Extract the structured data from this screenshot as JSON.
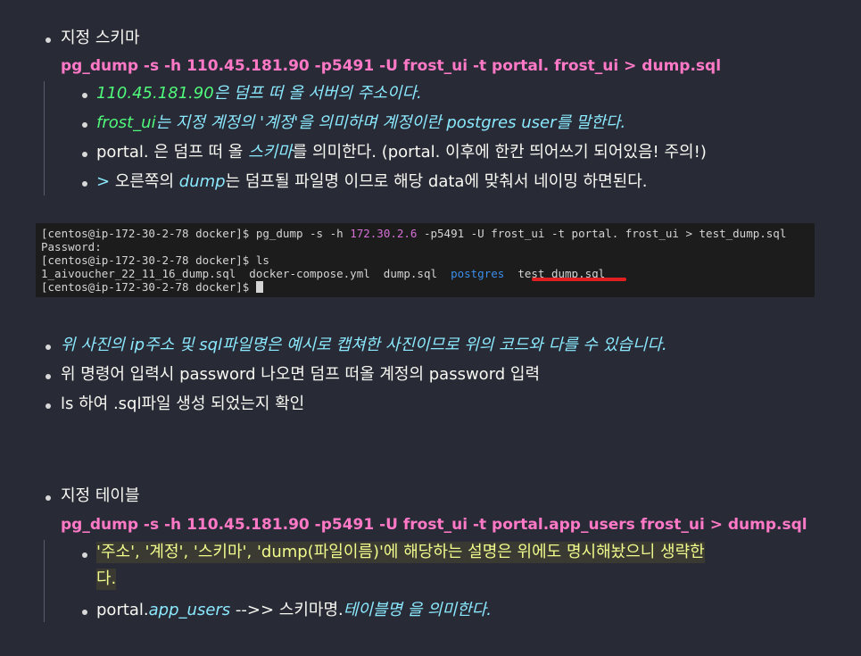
{
  "section1": {
    "title": "지정 스키마",
    "command": "pg_dump -s -h 110.45.181.90 -p5491 -U frost_ui -t portal. frost_ui > dump.sql",
    "items": [
      {
        "a": "110.45.181.90",
        "b": "은 덤프 떠 올 서버의 주소이다."
      },
      {
        "a": "frost_ui",
        "b": "는 지정 계정의 '계정'을 의미하며 계정이란 postgres user를 말한다."
      },
      {
        "a": "portal. 은 덤프 떠 올 ",
        "b": "스키마",
        "c": "를 의미한다. (portal. 이후에 한칸 띄어쓰기 되어있음! 주의!)"
      },
      {
        "a": "> ",
        "b": "오른쪽의 ",
        "c": "dump",
        "d": "는 덤프될 파일명 이므로 해당 data에 맞춰서 네이밍 하면된다."
      }
    ]
  },
  "terminal": {
    "line1_pre": "[centos@ip-172-30-2-78 docker]$ pg_dump -s -h ",
    "line1_ip": "172.30.2.6",
    "line1_post": " -p5491 -U frost_ui -t portal. frost_ui > test_dump.sql",
    "line2": "Password:",
    "line3": "[centos@ip-172-30-2-78 docker]$ ls",
    "line4_files": "1_aivoucher_22_11_16_dump.sql  docker-compose.yml  dump.sql  ",
    "line4_dir": "postgres",
    "line4_last": "  test_dump.sql",
    "line5": "[centos@ip-172-30-2-78 docker]$ "
  },
  "notes": [
    "위 사진의 ip주소 및 sql파일명은 예시로 캡쳐한 사진이므로 위의 코드와 다를 수 있습니다.",
    "위 명령어 입력시 password 나오면 덤프 떠올 계정의 password 입력",
    "ls 하여 .sql파일 생성 되었는지 확인"
  ],
  "section2": {
    "title": "지정 테이블",
    "command": "pg_dump -s -h 110.45.181.90 -p5491 -U frost_ui -t portal.app_users frost_ui > dump.sql",
    "item1_line1": "'주소', '계정', '스키마', 'dump(파일이름)'에 해당하는 설명은 위에도 명시해놨으니 생략한",
    "item1_line2": "다.",
    "item2_a": "portal.",
    "item2_b": "app_users",
    "item2_c": " -->> 스키마명.",
    "item2_d": "테이블명 을 의미한다."
  }
}
